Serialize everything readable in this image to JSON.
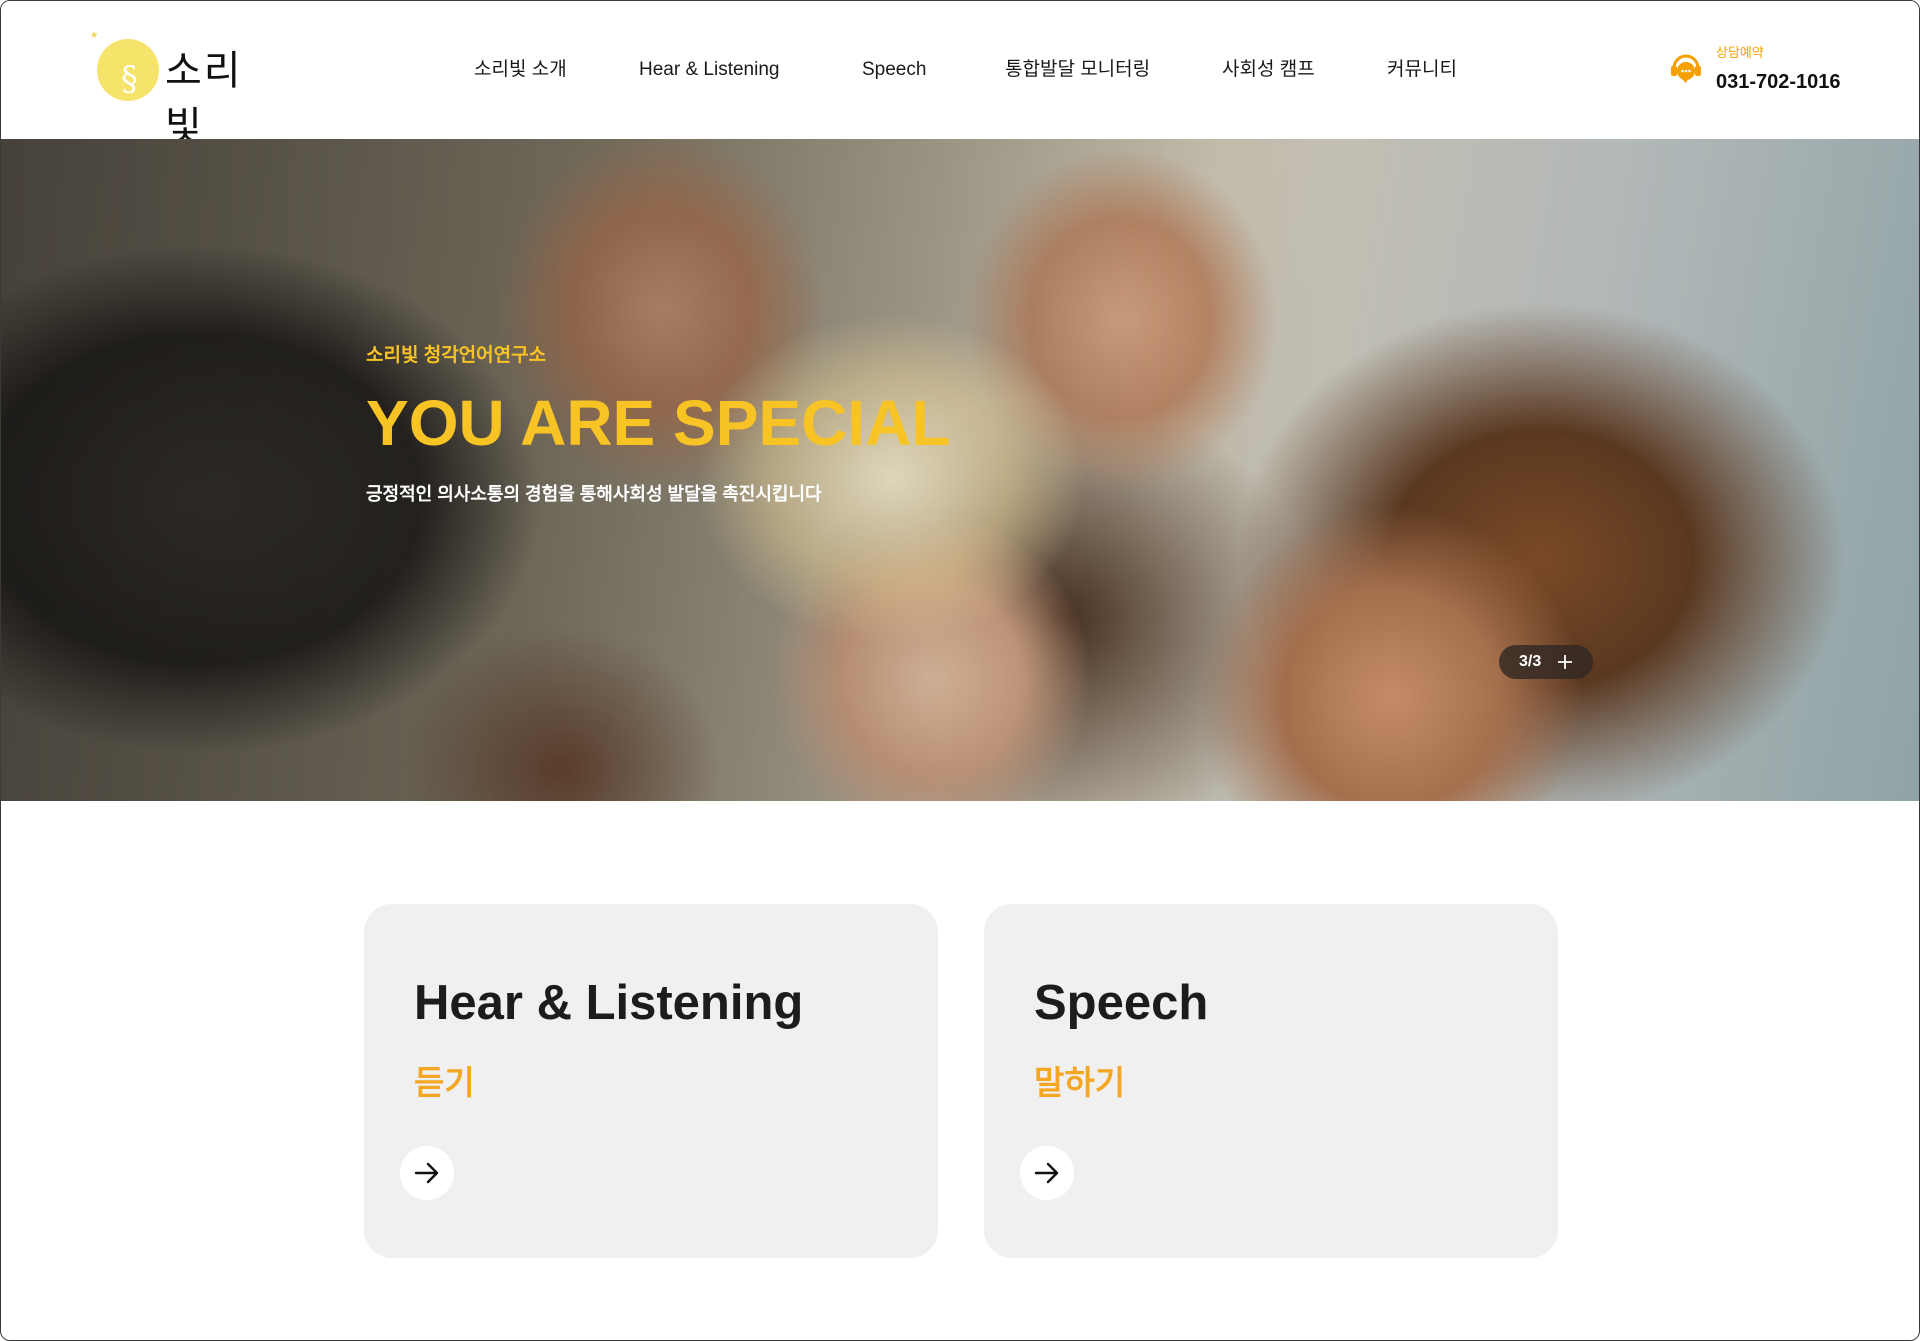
{
  "header": {
    "logo_text": "소리빛",
    "nav": [
      {
        "label": "소리빛 소개"
      },
      {
        "label": "Hear & Listening"
      },
      {
        "label": "Speech"
      },
      {
        "label": "통합발달 모니터링"
      },
      {
        "label": "사회성 캠프"
      },
      {
        "label": "커뮤니티"
      }
    ],
    "contact": {
      "label": "상담예약",
      "phone": "031-702-1016",
      "icon": "headset-icon"
    }
  },
  "hero": {
    "subtitle": "소리빛 청각언어연구소",
    "title": "YOU ARE SPECIAL",
    "description": "긍정적인 의사소통의 경험을 통해사회성 발달을 촉진시킵니다",
    "slide_counter": "3/3"
  },
  "cards": [
    {
      "title": "Hear & Listening",
      "subtitle": "듣기"
    },
    {
      "title": "Speech",
      "subtitle": "말하기"
    }
  ],
  "colors": {
    "accent": "#f7c325",
    "orange": "#f5a623",
    "card_bg": "#f0f0f0"
  }
}
